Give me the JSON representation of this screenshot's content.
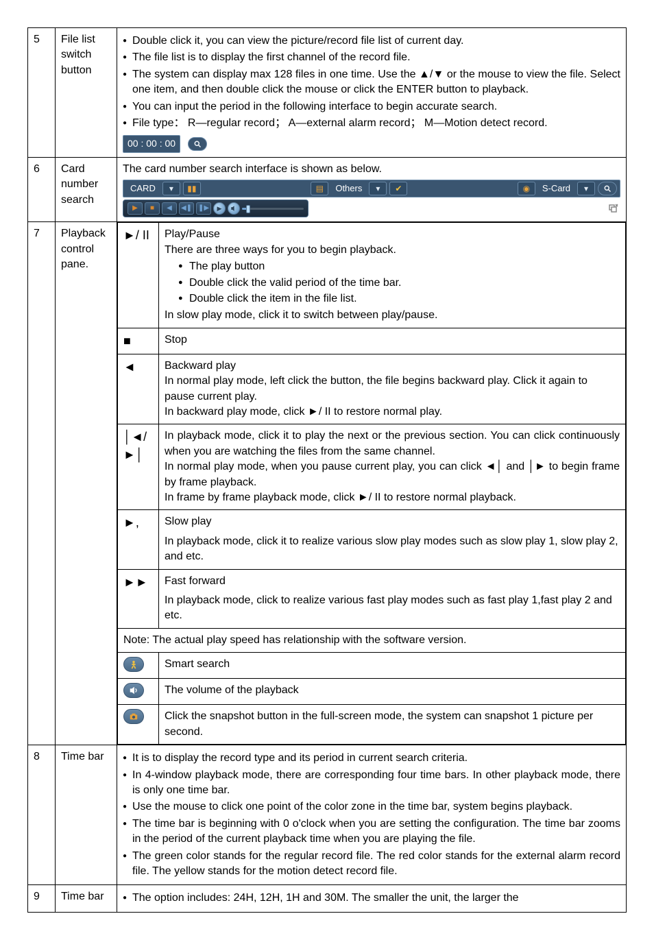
{
  "rows": {
    "r5": {
      "num": "5",
      "label": "File list switch button",
      "b1": "Double click it, you can view the picture/record file list of current day.",
      "b2": "The file list is to display the first channel of the record file.",
      "b3": "The system can display max 128 files in one time. Use the ▲/▼ or the mouse to view the file. Select one item, and then double click the mouse or click the ENTER button to playback.",
      "b4": "You can input the period in the following interface to begin accurate search.",
      "b5": "File type： R—regular record； A—external alarm record； M—Motion detect record.",
      "timebox": "00 : 00 : 00"
    },
    "r6": {
      "num": "6",
      "label": "Card number search",
      "line1": "The card number search interface is shown as below.",
      "card": "CARD",
      "others": "Others",
      "scard": "S-Card"
    },
    "r7": {
      "num": "7",
      "label": "Playback control pane.",
      "playpause": {
        "icon": "►/ II",
        "title": "Play/Pause",
        "line1": "There are three ways for you to begin playback.",
        "sb1": "The play button",
        "sb2": "Double click the valid period of the time bar.",
        "sb3": "Double click the item in the file list.",
        "line2": "In slow play mode, click it to switch between play/pause."
      },
      "stop": {
        "icon": "■",
        "text": "Stop"
      },
      "back": {
        "icon": "◄",
        "title": "Backward play",
        "l1": "In normal play mode, left click the button, the file begins backward play. Click it again to pause current play.",
        "l2": "In backward play mode, click ►/ II to restore normal play."
      },
      "frame": {
        "icon1": "│◄/",
        "icon2": "►│",
        "l1": "In playback mode, click it to play the next or the previous section. You can click continuously when you are watching the files from the same channel.",
        "l2": "In normal play mode, when you pause current play, you can click ◄│ and │► to begin frame by frame playback.",
        "l3": "In frame by frame playback mode, click ►/ II to restore normal playback."
      },
      "slow": {
        "icon": "►,",
        "title": "Slow play",
        "l1": "In playback mode, click it to realize various slow play modes such as slow play 1, slow play 2, and etc."
      },
      "fast": {
        "icon": "►►",
        "title": "Fast forward",
        "l1": "In playback mode, click to realize various fast play modes such as  fast play 1,fast play 2 and etc."
      },
      "note": "Note: The actual play speed has relationship with the software version.",
      "smart": "Smart search",
      "volume": "The volume of the playback",
      "snap": "Click the snapshot button in the full-screen mode, the system can snapshot 1 picture per second."
    },
    "r8": {
      "num": "8",
      "label": "Time bar",
      "b1": "It is to display the record type and its period in current search criteria.",
      "b2": "In 4-window playback mode, there are corresponding four time bars. In other playback mode, there is only one time bar.",
      "b3": "Use the mouse to click one point of the color zone in the time bar, system begins playback.",
      "b4": "The time bar is beginning with 0 o'clock when you are setting the configuration. The time bar zooms in the period of the current playback time when you are playing the file.",
      "b5": "The green color stands for the regular record file. The red color stands for the external alarm record file. The yellow stands for the motion detect record file."
    },
    "r9": {
      "num": "9",
      "label": "Time bar",
      "b1": "The option includes: 24H, 12H, 1H and 30M. The smaller the unit, the larger the"
    }
  }
}
